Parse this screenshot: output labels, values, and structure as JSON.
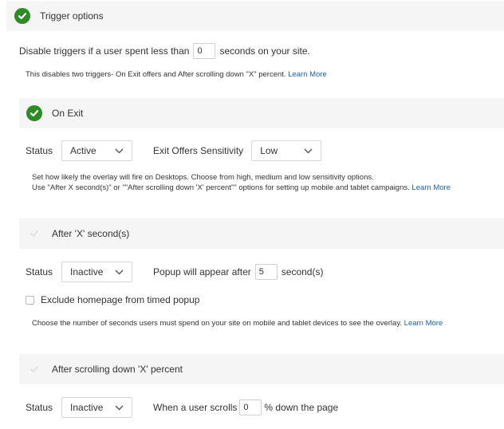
{
  "trigger_options": {
    "title": "Trigger options",
    "disable_prefix": "Disable triggers if a user spent less than",
    "disable_value": "0",
    "disable_suffix": "seconds on your site.",
    "help_text": "This disables two triggers- On Exit offers and After scrolling down \"X\" percent.",
    "help_link": "Learn More"
  },
  "on_exit": {
    "title": "On Exit",
    "status_label": "Status",
    "status_value": "Active",
    "sensitivity_label": "Exit Offers Sensitivity",
    "sensitivity_value": "Low",
    "help_line1": "Set how likely the overlay will fire on Desktops. Choose from high, medium and low sensitivity options.",
    "help_line2": "Use \"After X second(s)\" or \"\"After scrolling down 'X' percent\"\" options for setting up mobile and tablet campaigns.",
    "help_link": "Learn More"
  },
  "after_seconds": {
    "title": "After 'X' second(s)",
    "status_label": "Status",
    "status_value": "Inactive",
    "popup_prefix": "Popup will appear after",
    "popup_value": "5",
    "popup_suffix": "second(s)",
    "exclude_label": "Exclude homepage from timed popup",
    "help_text": "Choose the number of seconds users must spend on your site on mobile and tablet devices to see the overlay.",
    "help_link": "Learn More"
  },
  "after_scrolling": {
    "title": "After scrolling down 'X' percent",
    "status_label": "Status",
    "status_value": "Inactive",
    "scroll_prefix": "When a user scrolls",
    "scroll_value": "0",
    "scroll_suffix": "% down the page"
  },
  "colors": {
    "check_active": "#2e8b26",
    "link": "#1f5fa8",
    "header_bg": "#f5f5f5"
  },
  "icons": {
    "active_check": "check-circle-icon",
    "inactive_check": "check-icon",
    "dropdown": "chevron-down-icon"
  }
}
